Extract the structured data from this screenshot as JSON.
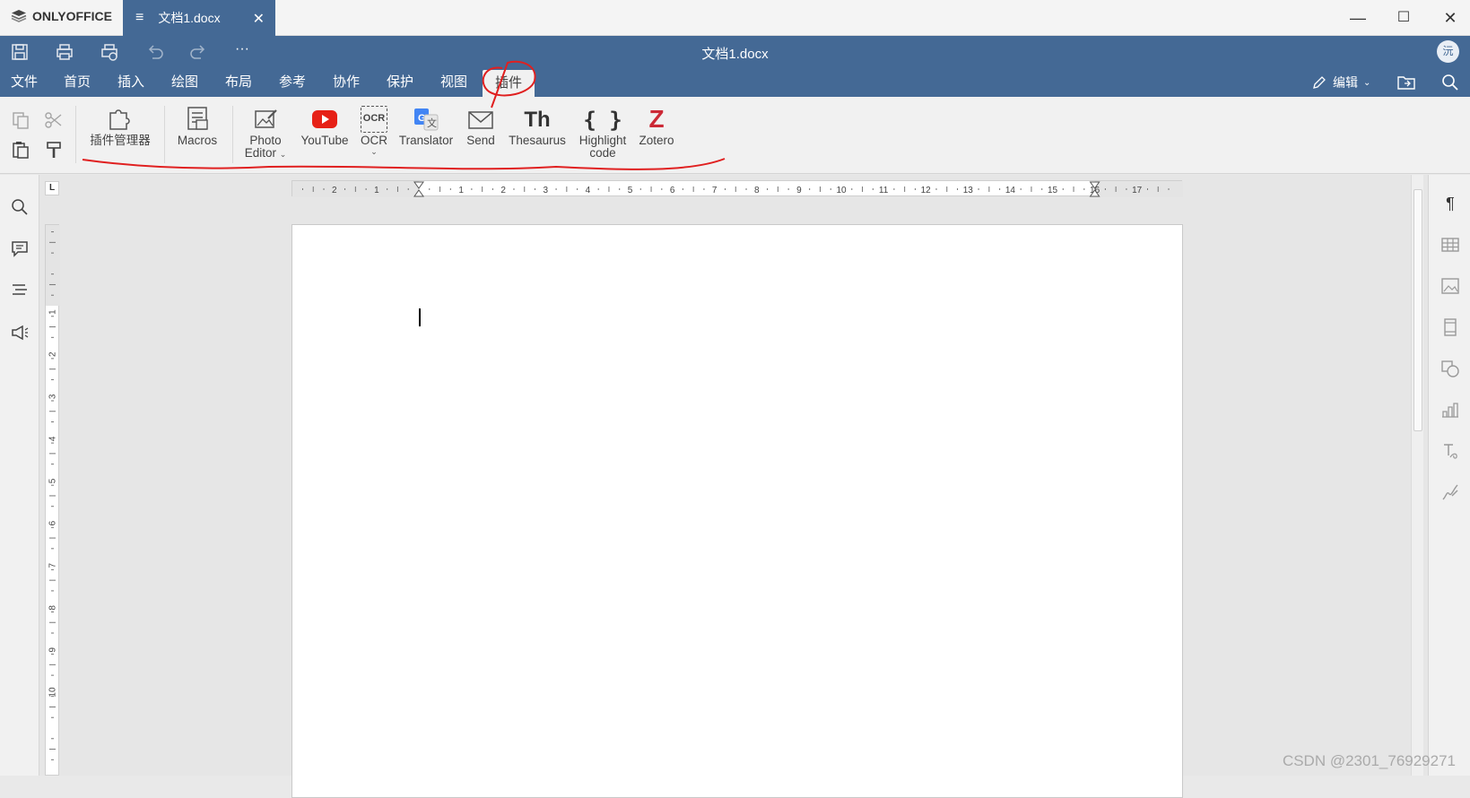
{
  "titlebar": {
    "brand": "ONLYOFFICE",
    "tab_label": "文档1.docx",
    "tab_close": "✕",
    "min": "—",
    "max": "☐",
    "close": "✕"
  },
  "appbar": {
    "doc_title": "文档1.docx",
    "more": "···",
    "avatar": "沅"
  },
  "menu": {
    "items": [
      "文件",
      "首页",
      "插入",
      "绘图",
      "布局",
      "参考",
      "协作",
      "保护",
      "视图",
      "插件"
    ],
    "active": "插件",
    "edit_label": "编辑"
  },
  "ribbon": {
    "plugin_manager": "插件管理器",
    "macros": "Macros",
    "photo_editor_1": "Photo",
    "photo_editor_2": "Editor",
    "youtube": "YouTube",
    "ocr": "OCR",
    "ocr_icon_text": "OCR",
    "translator": "Translator",
    "send": "Send",
    "thesaurus": "Thesaurus",
    "thesaurus_icon_text": "Th",
    "highlight_1": "Highlight",
    "highlight_2": "code",
    "highlight_icon_text": "{ }",
    "zotero": "Zotero",
    "zotero_icon_text": "Z",
    "caret": "⌄"
  },
  "ruler": {
    "corner": "L",
    "h_labels": [
      "2",
      "1",
      "1",
      "2",
      "3",
      "4",
      "5",
      "6",
      "7",
      "8",
      "9",
      "10",
      "11",
      "12",
      "13",
      "14",
      "15",
      "16",
      "17"
    ],
    "v_labels": [
      "1",
      "2",
      "3",
      "4",
      "5",
      "6",
      "7",
      "8",
      "9",
      "10"
    ]
  },
  "watermark": "CSDN @2301_76929271",
  "colors": {
    "brand_blue": "#446995",
    "annotation_red": "#e02020"
  }
}
